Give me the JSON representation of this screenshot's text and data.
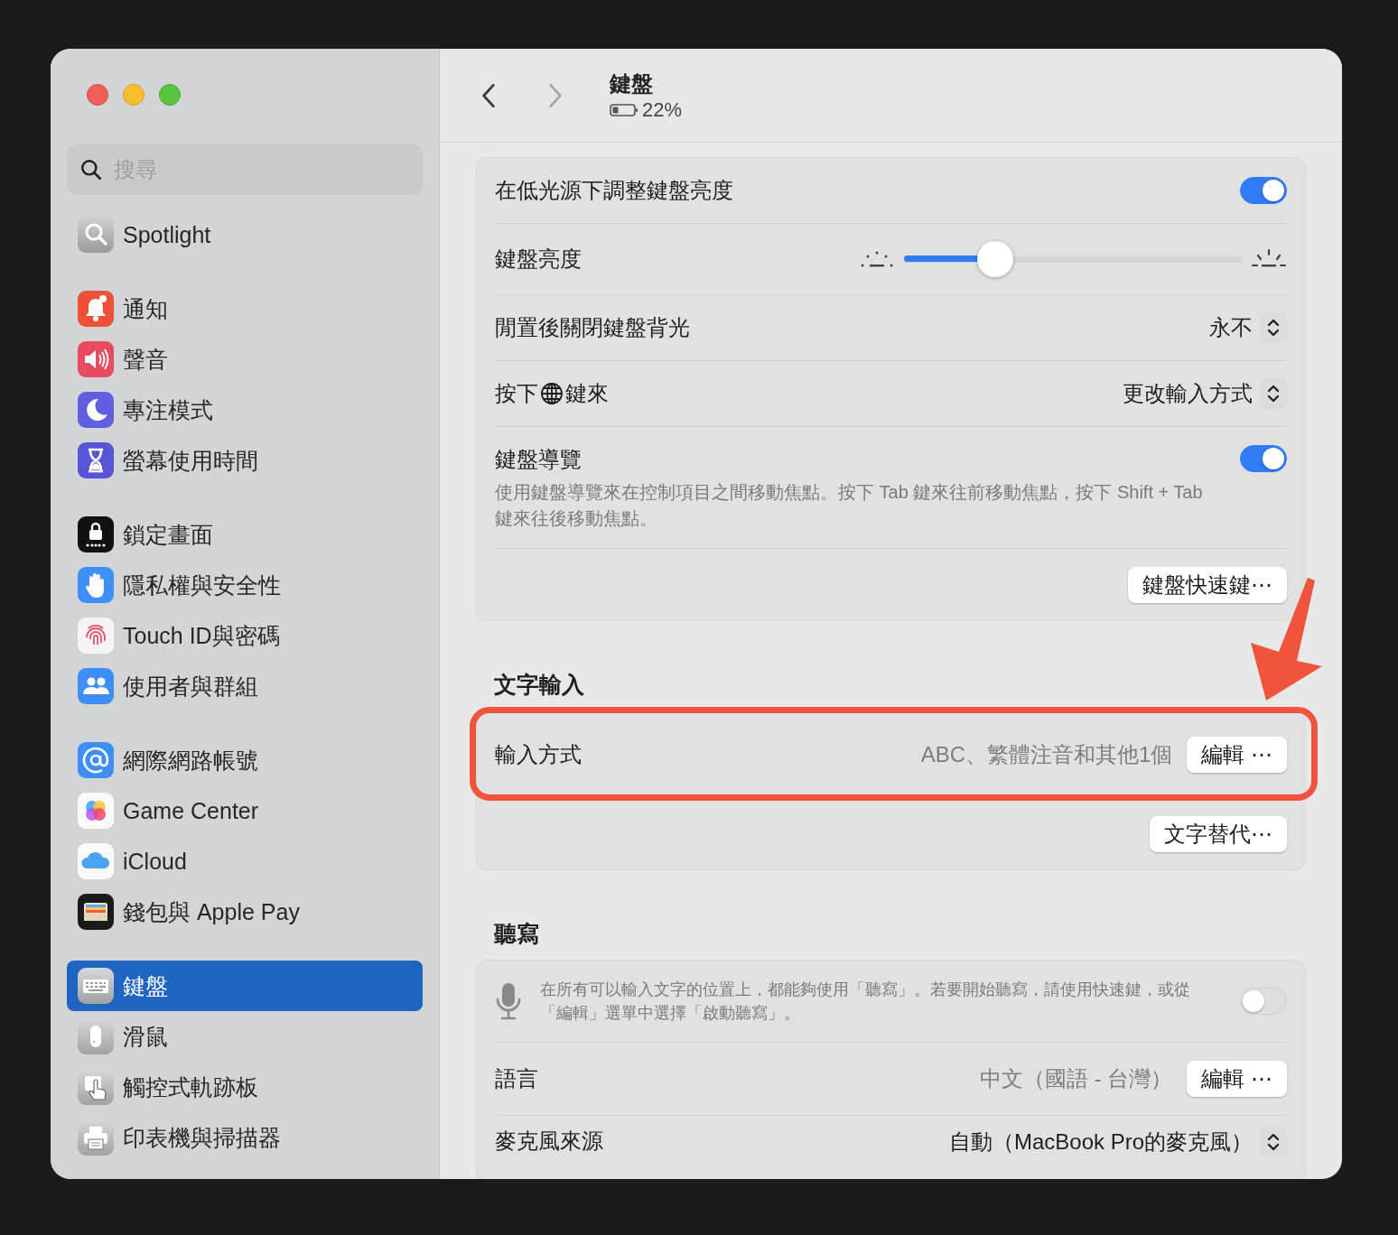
{
  "sidebar": {
    "search": {
      "placeholder": "搜尋"
    },
    "groups": [
      {
        "items": [
          {
            "label": "Spotlight",
            "selected": false
          }
        ]
      },
      {
        "items": [
          {
            "label": "通知",
            "selected": false
          },
          {
            "label": "聲音",
            "selected": false
          },
          {
            "label": "專注模式",
            "selected": false
          },
          {
            "label": "螢幕使用時間",
            "selected": false
          }
        ]
      },
      {
        "items": [
          {
            "label": "鎖定畫面",
            "selected": false
          },
          {
            "label": "隱私權與安全性",
            "selected": false
          },
          {
            "label": "Touch ID與密碼",
            "selected": false
          },
          {
            "label": "使用者與群組",
            "selected": false
          }
        ]
      },
      {
        "items": [
          {
            "label": "網際網路帳號",
            "selected": false
          },
          {
            "label": "Game Center",
            "selected": false
          },
          {
            "label": "iCloud",
            "selected": false
          },
          {
            "label": "錢包與 Apple Pay",
            "selected": false
          }
        ]
      },
      {
        "items": [
          {
            "label": "鍵盤",
            "selected": true
          },
          {
            "label": "滑鼠",
            "selected": false
          },
          {
            "label": "觸控式軌跡板",
            "selected": false
          },
          {
            "label": "印表機與掃描器",
            "selected": false
          }
        ]
      }
    ]
  },
  "header": {
    "title": "鍵盤",
    "battery": "22%"
  },
  "sections": [
    {
      "rows": [
        {
          "kind": "toggle",
          "label": "在低光源下調整鍵盤亮度",
          "on": true
        },
        {
          "kind": "slider",
          "label": "鍵盤亮度",
          "level": 0.27
        },
        {
          "kind": "popup",
          "label": "閒置後關閉鍵盤背光",
          "value": "永不"
        },
        {
          "kind": "popup",
          "label": "按下",
          "label_after": "鍵來",
          "value": "更改輸入方式"
        },
        {
          "kind": "toggle",
          "label": "鍵盤導覽",
          "description": "使用鍵盤導覽來在控制項目之間移動焦點。按下 Tab 鍵來往前移動焦點，按下 Shift + Tab 鍵來往後移動焦點。",
          "on": true
        },
        {
          "kind": "buttons",
          "buttons": [
            "鍵盤快速鍵⋯"
          ]
        }
      ]
    },
    {
      "title": "文字輸入",
      "rows": [
        {
          "kind": "value-button",
          "label": "輸入方式",
          "value": "ABC、繁體注音和其他1個",
          "button": "編輯 ⋯",
          "highlighted": true
        },
        {
          "kind": "buttons",
          "buttons": [
            "文字替代⋯"
          ]
        }
      ]
    },
    {
      "title": "聽寫",
      "rows": [
        {
          "kind": "mic-toggle",
          "description": "在所有可以輸入文字的位置上，都能夠使用「聽寫」。若要開始聽寫，請使用快速鍵，或從「編輯」選單中選擇「啟動聽寫」。",
          "on": false
        },
        {
          "kind": "value-button",
          "label": "語言",
          "value": "中文（國語 - 台灣）",
          "button": "編輯 ⋯",
          "highlighted": false
        },
        {
          "kind": "popup",
          "label": "麥克風來源",
          "value": "自動（MacBook Pro的麥克風）"
        }
      ]
    }
  ]
}
